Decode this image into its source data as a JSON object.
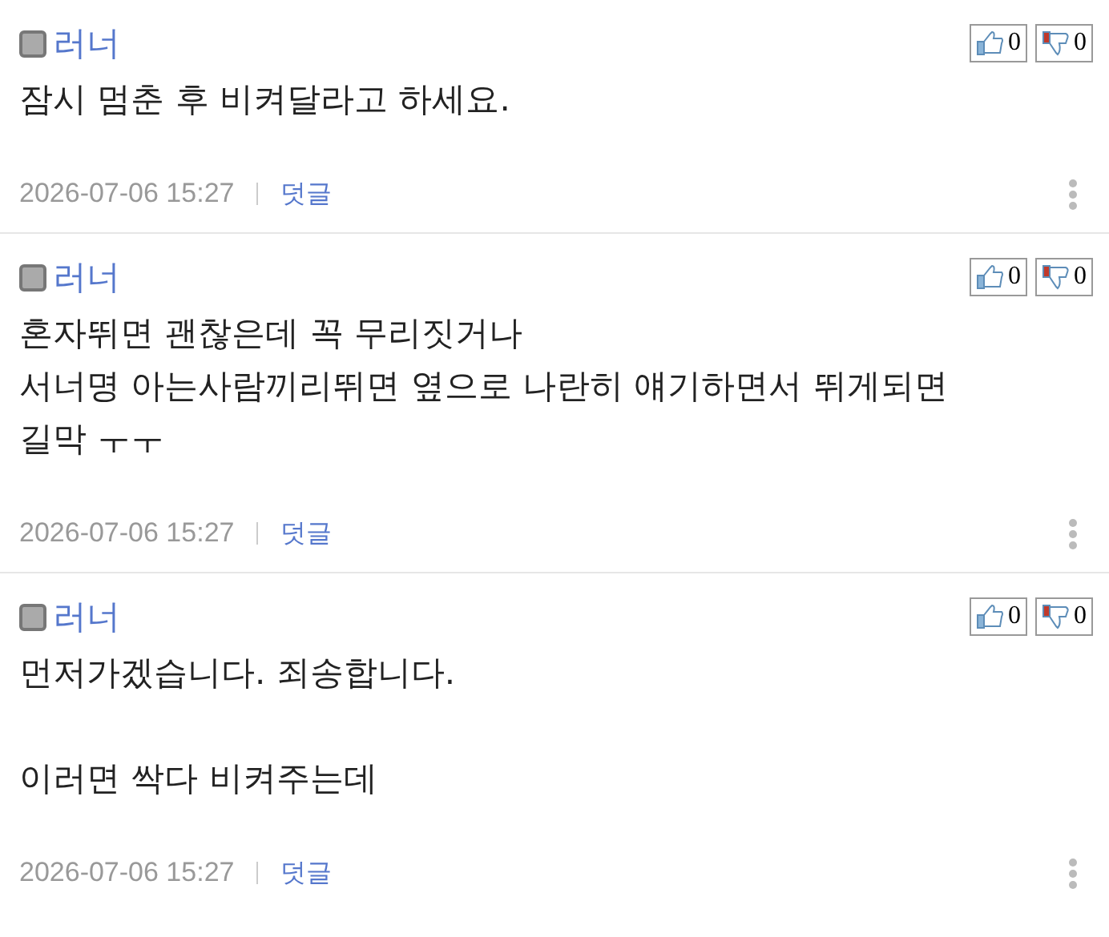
{
  "comments": [
    {
      "author": "러너",
      "likes": "0",
      "dislikes": "0",
      "paragraphs": [
        [
          "잠시 멈춘 후 비켜달라고 하세요."
        ]
      ],
      "time": "2026-07-06 15:27",
      "reply": "덧글"
    },
    {
      "author": "러너",
      "likes": "0",
      "dislikes": "0",
      "paragraphs": [
        [
          "혼자뛰면 괜찮은데 꼭 무리짓거나",
          "서너명 아는사람끼리뛰면 옆으로 나란히 얘기하면서 뛰게되면",
          "길막 ㅜㅜ"
        ]
      ],
      "time": "2026-07-06 15:27",
      "reply": "덧글"
    },
    {
      "author": "러너",
      "likes": "0",
      "dislikes": "0",
      "paragraphs": [
        [
          "먼저가겠습니다. 죄송합니다."
        ],
        [
          "이러면 싹다 비켜주는데"
        ]
      ],
      "time": "2026-07-06 15:27",
      "reply": "덧글"
    }
  ]
}
